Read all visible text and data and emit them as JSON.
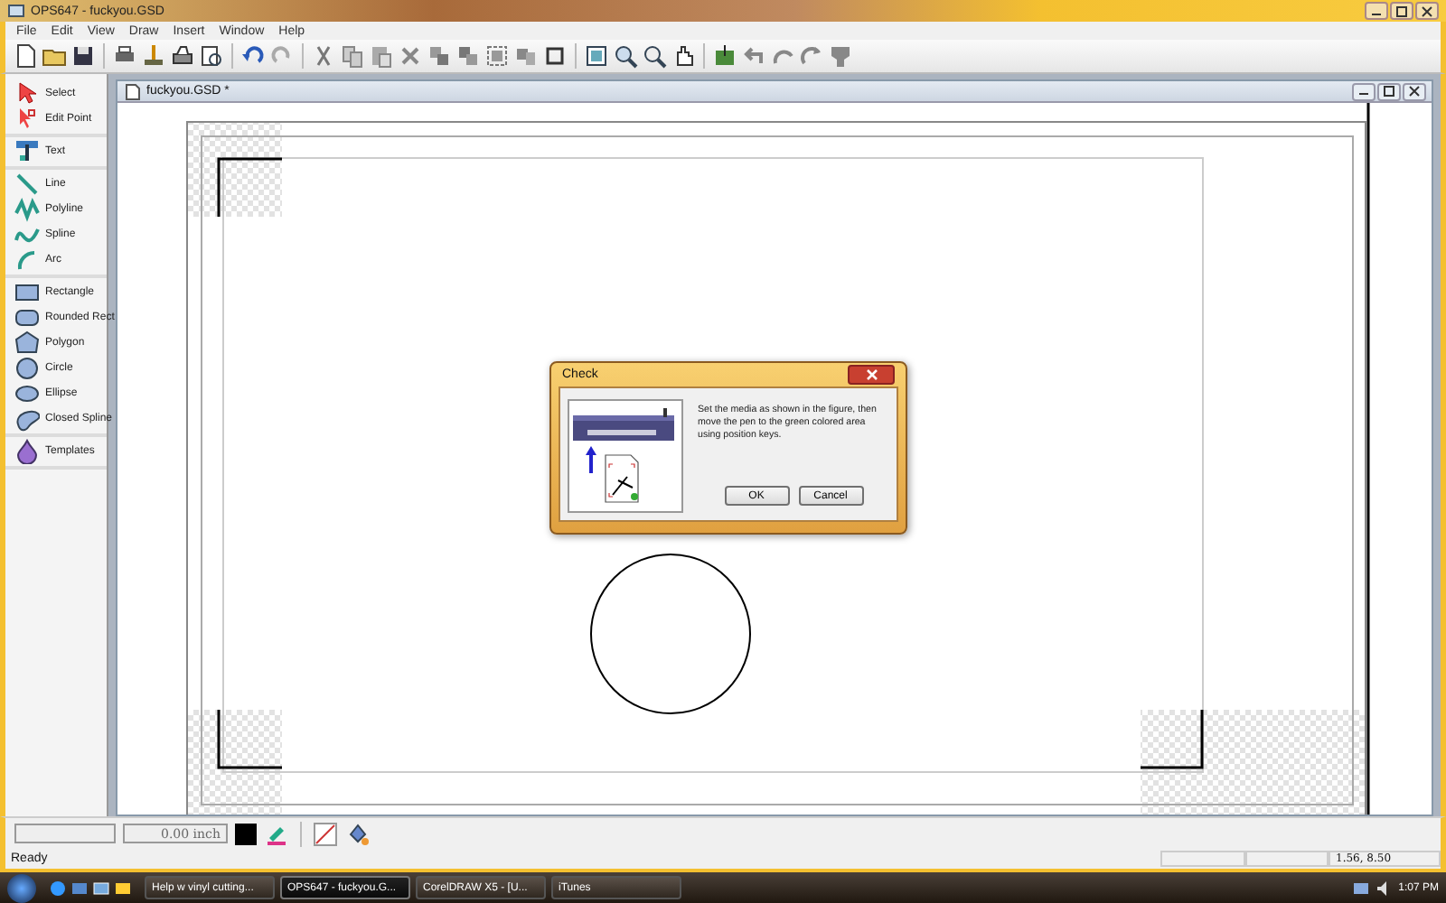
{
  "window": {
    "title": "OPS647 - fuckyou.GSD"
  },
  "menu": [
    "File",
    "Edit",
    "View",
    "Draw",
    "Insert",
    "Window",
    "Help"
  ],
  "tool_groups": [
    [
      {
        "label": "Select"
      },
      {
        "label": "Edit Point"
      }
    ],
    [
      {
        "label": "Text"
      }
    ],
    [
      {
        "label": "Line"
      },
      {
        "label": "Polyline"
      },
      {
        "label": "Spline"
      },
      {
        "label": "Arc"
      }
    ],
    [
      {
        "label": "Rectangle"
      },
      {
        "label": "Rounded Rect"
      },
      {
        "label": "Polygon"
      },
      {
        "label": "Circle"
      },
      {
        "label": "Ellipse"
      },
      {
        "label": "Closed Spline"
      }
    ],
    [
      {
        "label": "Templates"
      }
    ]
  ],
  "document": {
    "title": "fuckyou.GSD *"
  },
  "dialog": {
    "title": "Check",
    "message": "Set the media as shown in the figure, then move the pen to the green colored area using position keys.",
    "buttons": [
      "OK",
      "Cancel"
    ]
  },
  "bottom_toolbar": {
    "length": "0.00 inch"
  },
  "status_bar": {
    "text": "Ready",
    "coordinates": "1.56, 8.50"
  },
  "taskbar": {
    "buttons": [
      {
        "label": "Help w vinyl cutting...",
        "selected": false
      },
      {
        "label": "OPS647 - fuckyou.G...",
        "selected": true
      },
      {
        "label": "CorelDRAW X5 - [U...",
        "selected": false
      },
      {
        "label": "iTunes",
        "selected": false
      }
    ],
    "clock": "1:07 PM"
  }
}
